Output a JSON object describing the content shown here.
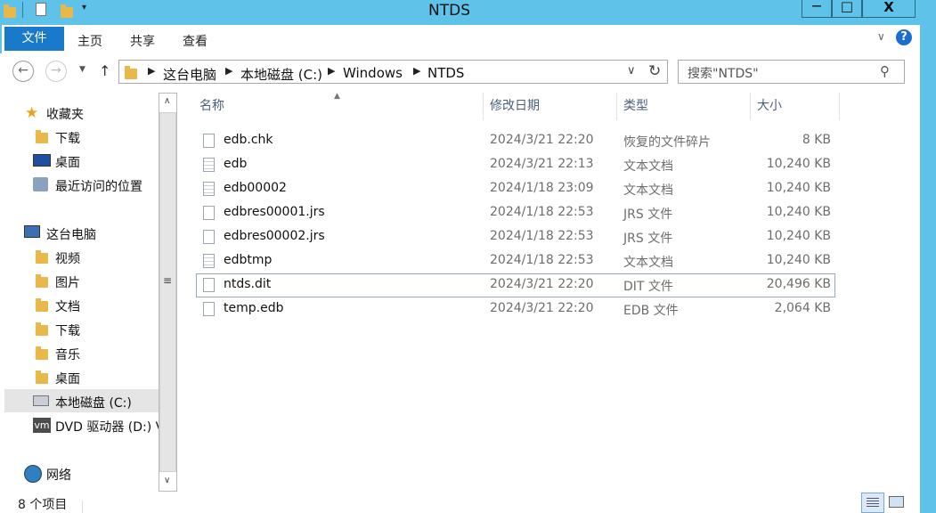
{
  "window": {
    "title": "NTDS"
  },
  "window_controls": {
    "minimize": "—",
    "maximize": "□",
    "close": "X"
  },
  "ribbon": {
    "tabs": [
      "文件",
      "主页",
      "共享",
      "查看"
    ]
  },
  "address": {
    "crumbs": [
      "这台电脑",
      "本地磁盘 (C:)",
      "Windows",
      "NTDS"
    ]
  },
  "search": {
    "placeholder": "搜索\"NTDS\""
  },
  "nav": {
    "favorites": {
      "label": "收藏夹",
      "items": [
        "下载",
        "桌面",
        "最近访问的位置"
      ]
    },
    "this_pc": {
      "label": "这台电脑",
      "items": [
        "视频",
        "图片",
        "文档",
        "下载",
        "音乐",
        "桌面",
        "本地磁盘 (C:)",
        "DVD 驱动器 (D:) V"
      ]
    },
    "network": {
      "label": "网络"
    },
    "selected": "本地磁盘 (C:)"
  },
  "columns": [
    "名称",
    "修改日期",
    "类型",
    "大小"
  ],
  "files": [
    {
      "name": "edb.chk",
      "date": "2024/3/21 22:20",
      "type": "恢复的文件碎片",
      "size": "8 KB",
      "icon": "chk-file-icon"
    },
    {
      "name": "edb",
      "date": "2024/3/21 22:13",
      "type": "文本文档",
      "size": "10,240 KB",
      "icon": "text-file-icon"
    },
    {
      "name": "edb00002",
      "date": "2024/1/18 23:09",
      "type": "文本文档",
      "size": "10,240 KB",
      "icon": "text-file-icon"
    },
    {
      "name": "edbres00001.jrs",
      "date": "2024/1/18 22:53",
      "type": "JRS 文件",
      "size": "10,240 KB",
      "icon": "blank-file-icon"
    },
    {
      "name": "edbres00002.jrs",
      "date": "2024/1/18 22:53",
      "type": "JRS 文件",
      "size": "10,240 KB",
      "icon": "blank-file-icon"
    },
    {
      "name": "edbtmp",
      "date": "2024/1/18 22:53",
      "type": "文本文档",
      "size": "10,240 KB",
      "icon": "text-file-icon"
    },
    {
      "name": "ntds.dit",
      "date": "2024/3/21 22:20",
      "type": "DIT 文件",
      "size": "20,496 KB",
      "icon": "blank-file-icon"
    },
    {
      "name": "temp.edb",
      "date": "2024/3/21 22:20",
      "type": "EDB 文件",
      "size": "2,064 KB",
      "icon": "blank-file-icon"
    }
  ],
  "selected_file": "ntds.dit",
  "status": {
    "count": "8 个项目"
  },
  "colors": {
    "titlebar": "#5fc2e8",
    "file_tab": "#1979ca",
    "header_text": "#4c607a"
  }
}
